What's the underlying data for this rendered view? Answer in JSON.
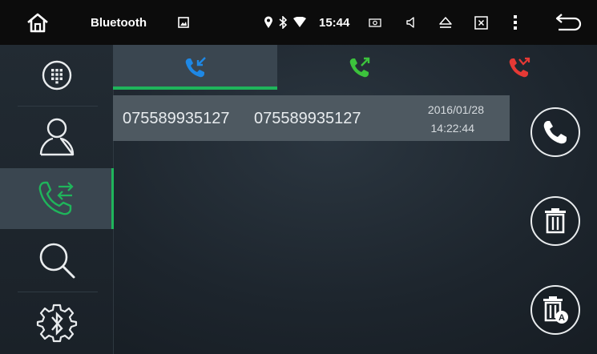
{
  "statusbar": {
    "title": "Bluetooth",
    "time": "15:44",
    "icons": [
      "home-icon",
      "image-icon",
      "location-icon",
      "bluetooth-icon",
      "wifi-icon",
      "screenshot-icon",
      "volume-icon",
      "eject-icon",
      "close-window-icon",
      "more-icon",
      "back-icon"
    ]
  },
  "sidebar": {
    "items": [
      {
        "name": "dialpad",
        "icon": "dialpad-icon"
      },
      {
        "name": "contacts",
        "icon": "contact-icon"
      },
      {
        "name": "call-log",
        "icon": "call-log-icon",
        "active": true
      },
      {
        "name": "search",
        "icon": "search-icon"
      },
      {
        "name": "bluetooth-settings",
        "icon": "bluetooth-settings-icon"
      }
    ]
  },
  "tabs": [
    {
      "name": "received-calls",
      "icon": "incoming-call-icon",
      "color": "#1e88e5",
      "active": true
    },
    {
      "name": "dialed-calls",
      "icon": "outgoing-call-icon",
      "color": "#3cc23c"
    },
    {
      "name": "missed-calls",
      "icon": "missed-call-icon",
      "color": "#e53935"
    }
  ],
  "records": [
    {
      "name": "075589935127",
      "number": "075589935127",
      "date": "2016/01/28",
      "time": "14:22:44"
    }
  ],
  "actions": [
    {
      "name": "call",
      "icon": "phone-icon"
    },
    {
      "name": "delete",
      "icon": "trash-icon"
    },
    {
      "name": "delete-all",
      "icon": "trash-all-icon",
      "badge": "A"
    }
  ],
  "colors": {
    "accent": "#1fb55b",
    "incoming": "#1e88e5",
    "outgoing": "#3cc23c",
    "missed": "#e53935"
  }
}
